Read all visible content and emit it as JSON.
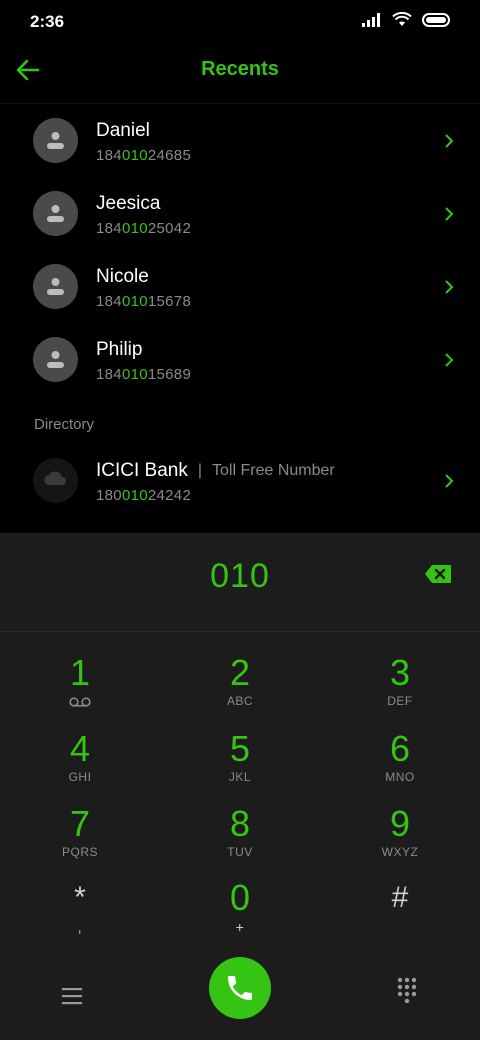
{
  "status_bar": {
    "time": "2:36"
  },
  "header": {
    "title": "Recents"
  },
  "contacts": [
    {
      "name": "Daniel",
      "num_prefix": "184",
      "num_match": "010",
      "num_suffix": "24685"
    },
    {
      "name": "Jeesica",
      "num_prefix": "184",
      "num_match": "010",
      "num_suffix": "25042"
    },
    {
      "name": "Nicole",
      "num_prefix": "184",
      "num_match": "010",
      "num_suffix": "15678"
    },
    {
      "name": "Philip",
      "num_prefix": "184",
      "num_match": "010",
      "num_suffix": "15689"
    }
  ],
  "directory": {
    "label": "Directory",
    "entry": {
      "name": "ICICI Bank",
      "separator": "|",
      "tag": "Toll Free Number",
      "num_prefix": "180",
      "num_match": "010",
      "num_suffix": "24242"
    }
  },
  "dialer": {
    "input": "010",
    "keys": [
      {
        "num": "1",
        "letters": ""
      },
      {
        "num": "2",
        "letters": "ABC"
      },
      {
        "num": "3",
        "letters": "DEF"
      },
      {
        "num": "4",
        "letters": "GHI"
      },
      {
        "num": "5",
        "letters": "JKL"
      },
      {
        "num": "6",
        "letters": "MNO"
      },
      {
        "num": "7",
        "letters": "PQRS"
      },
      {
        "num": "8",
        "letters": "TUV"
      },
      {
        "num": "9",
        "letters": "WXYZ"
      },
      {
        "num": "*",
        "letters": ","
      },
      {
        "num": "0",
        "letters": "+"
      },
      {
        "num": "#",
        "letters": ""
      }
    ]
  },
  "colors": {
    "accent": "#35c414",
    "muted": "#8a8a8a",
    "dialer_bg": "#1c1c1c",
    "avatar": "#4a4a4a"
  }
}
